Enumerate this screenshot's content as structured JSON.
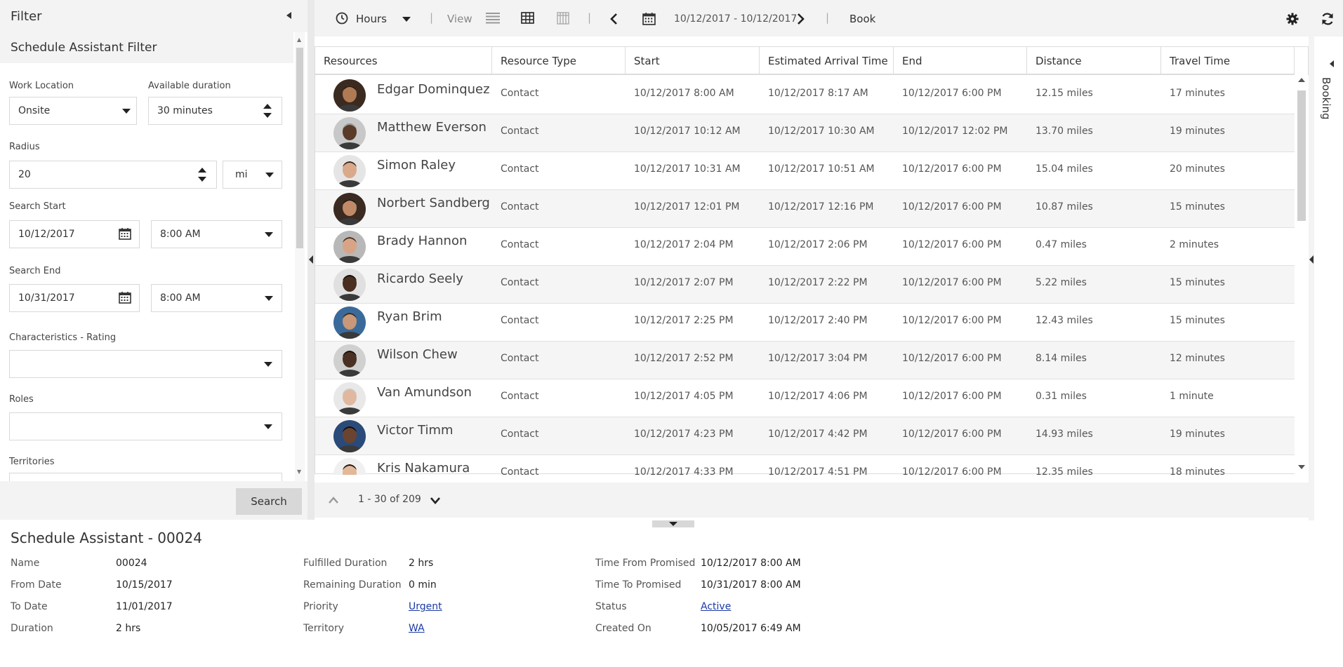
{
  "filter": {
    "title": "Filter",
    "section_title": "Schedule Assistant Filter",
    "work_location": {
      "label": "Work Location",
      "value": "Onsite"
    },
    "available_duration": {
      "label": "Available duration",
      "value": "30 minutes"
    },
    "radius": {
      "label": "Radius",
      "value": "20",
      "unit": "mi"
    },
    "search_start": {
      "label": "Search Start",
      "date": "10/12/2017",
      "time": "8:00 AM"
    },
    "search_end": {
      "label": "Search End",
      "date": "10/31/2017",
      "time": "8:00 AM"
    },
    "characteristics": {
      "label": "Characteristics - Rating",
      "value": ""
    },
    "roles": {
      "label": "Roles",
      "value": ""
    },
    "territories": {
      "label": "Territories"
    },
    "search_button": "Search"
  },
  "toolbar": {
    "hours": "Hours",
    "view": "View",
    "date_range": "10/12/2017 - 10/12/2017",
    "book": "Book"
  },
  "grid": {
    "columns": [
      "Resources",
      "Resource Type",
      "Start",
      "Estimated Arrival Time",
      "End",
      "Distance",
      "Travel Time"
    ],
    "rows": [
      {
        "name": "Edgar Dominquez",
        "type": "Contact",
        "start": "10/12/2017 8:00 AM",
        "eta": "10/12/2017 8:17 AM",
        "end": "10/12/2017 6:00 PM",
        "distance": "12.15 miles",
        "travel": "17 minutes",
        "skin": "#b07a55",
        "hair": "#2a1a10",
        "bg": "#3b2a20"
      },
      {
        "name": "Matthew Everson",
        "type": "Contact",
        "start": "10/12/2017 10:12 AM",
        "eta": "10/12/2017 10:30 AM",
        "end": "10/12/2017 12:02 PM",
        "distance": "13.70 miles",
        "travel": "19 minutes",
        "skin": "#5a3a28",
        "hair": "#9a9a9a",
        "bg": "#c8c8c8"
      },
      {
        "name": "Simon Raley",
        "type": "Contact",
        "start": "10/12/2017 10:31 AM",
        "eta": "10/12/2017 10:51 AM",
        "end": "10/12/2017 6:00 PM",
        "distance": "15.04 miles",
        "travel": "20 minutes",
        "skin": "#d9a98a",
        "hair": "#3a2a1e",
        "bg": "#e5e5e5"
      },
      {
        "name": "Norbert Sandberg",
        "type": "Contact",
        "start": "10/12/2017 12:01 PM",
        "eta": "10/12/2017 12:16 PM",
        "end": "10/12/2017 6:00 PM",
        "distance": "10.87 miles",
        "travel": "15 minutes",
        "skin": "#c08a68",
        "hair": "#201510",
        "bg": "#3a2a22"
      },
      {
        "name": "Brady Hannon",
        "type": "Contact",
        "start": "10/12/2017 2:04 PM",
        "eta": "10/12/2017 2:06 PM",
        "end": "10/12/2017 6:00 PM",
        "distance": "0.47 miles",
        "travel": "2 minutes",
        "skin": "#d8a486",
        "hair": "#4a3020",
        "bg": "#b8b8b8"
      },
      {
        "name": "Ricardo Seely",
        "type": "Contact",
        "start": "10/12/2017 2:07 PM",
        "eta": "10/12/2017 2:22 PM",
        "end": "10/12/2017 6:00 PM",
        "distance": "5.22 miles",
        "travel": "15 minutes",
        "skin": "#4a2e20",
        "hair": "#1a100a",
        "bg": "#e0e0e0"
      },
      {
        "name": "Ryan Brim",
        "type": "Contact",
        "start": "10/12/2017 2:25 PM",
        "eta": "10/12/2017 2:40 PM",
        "end": "10/12/2017 6:00 PM",
        "distance": "12.43 miles",
        "travel": "15 minutes",
        "skin": "#c89878",
        "hair": "#3a2818",
        "bg": "#3a6a9a"
      },
      {
        "name": "Wilson Chew",
        "type": "Contact",
        "start": "10/12/2017 2:52 PM",
        "eta": "10/12/2017 3:04 PM",
        "end": "10/12/2017 6:00 PM",
        "distance": "8.14 miles",
        "travel": "12 minutes",
        "skin": "#4a3022",
        "hair": "#181008",
        "bg": "#d0d0d0"
      },
      {
        "name": "Van Amundson",
        "type": "Contact",
        "start": "10/12/2017 4:05 PM",
        "eta": "10/12/2017 4:06 PM",
        "end": "10/12/2017 6:00 PM",
        "distance": "0.31 miles",
        "travel": "1 minute",
        "skin": "#e0b8a0",
        "hair": "#c8c8c8",
        "bg": "#e8e8e8"
      },
      {
        "name": "Victor Timm",
        "type": "Contact",
        "start": "10/12/2017 4:23 PM",
        "eta": "10/12/2017 4:42 PM",
        "end": "10/12/2017 6:00 PM",
        "distance": "14.93 miles",
        "travel": "19 minutes",
        "skin": "#6a4430",
        "hair": "#100a06",
        "bg": "#2a4a7a"
      },
      {
        "name": "Kris Nakamura",
        "type": "Contact",
        "start": "10/12/2017 4:33 PM",
        "eta": "10/12/2017 4:51 PM",
        "end": "10/12/2017 6:00 PM",
        "distance": "12.35 miles",
        "travel": "18 minutes",
        "skin": "#e2b898",
        "hair": "#1a120c",
        "bg": "#f0f0f0"
      }
    ]
  },
  "paging": {
    "text": "1 - 30 of 209"
  },
  "right_rail": {
    "label": "Booking"
  },
  "details": {
    "title": "Schedule Assistant - 00024",
    "col1": [
      {
        "label": "Name",
        "value": "00024"
      },
      {
        "label": "From Date",
        "value": "10/15/2017"
      },
      {
        "label": "To Date",
        "value": "11/01/2017"
      },
      {
        "label": "Duration",
        "value": "2 hrs"
      }
    ],
    "col2": [
      {
        "label": "Fulfilled Duration",
        "value": "2 hrs"
      },
      {
        "label": "Remaining Duration",
        "value": "0 min"
      },
      {
        "label": "Priority",
        "value": "Urgent"
      },
      {
        "label": "Territory",
        "value": "WA"
      }
    ],
    "col3": [
      {
        "label": "Time From Promised",
        "value": "10/12/2017 8:00 AM"
      },
      {
        "label": "Time To Promised",
        "value": "10/31/2017 8:00 AM"
      },
      {
        "label": "Status",
        "value": "Active"
      },
      {
        "label": "Created On",
        "value": "10/05/2017 6:49 AM"
      }
    ]
  },
  "colors": {
    "link": "#1a3aa6",
    "panel_bg": "#f3f3f3",
    "row_alt": "#f5f5f5"
  }
}
